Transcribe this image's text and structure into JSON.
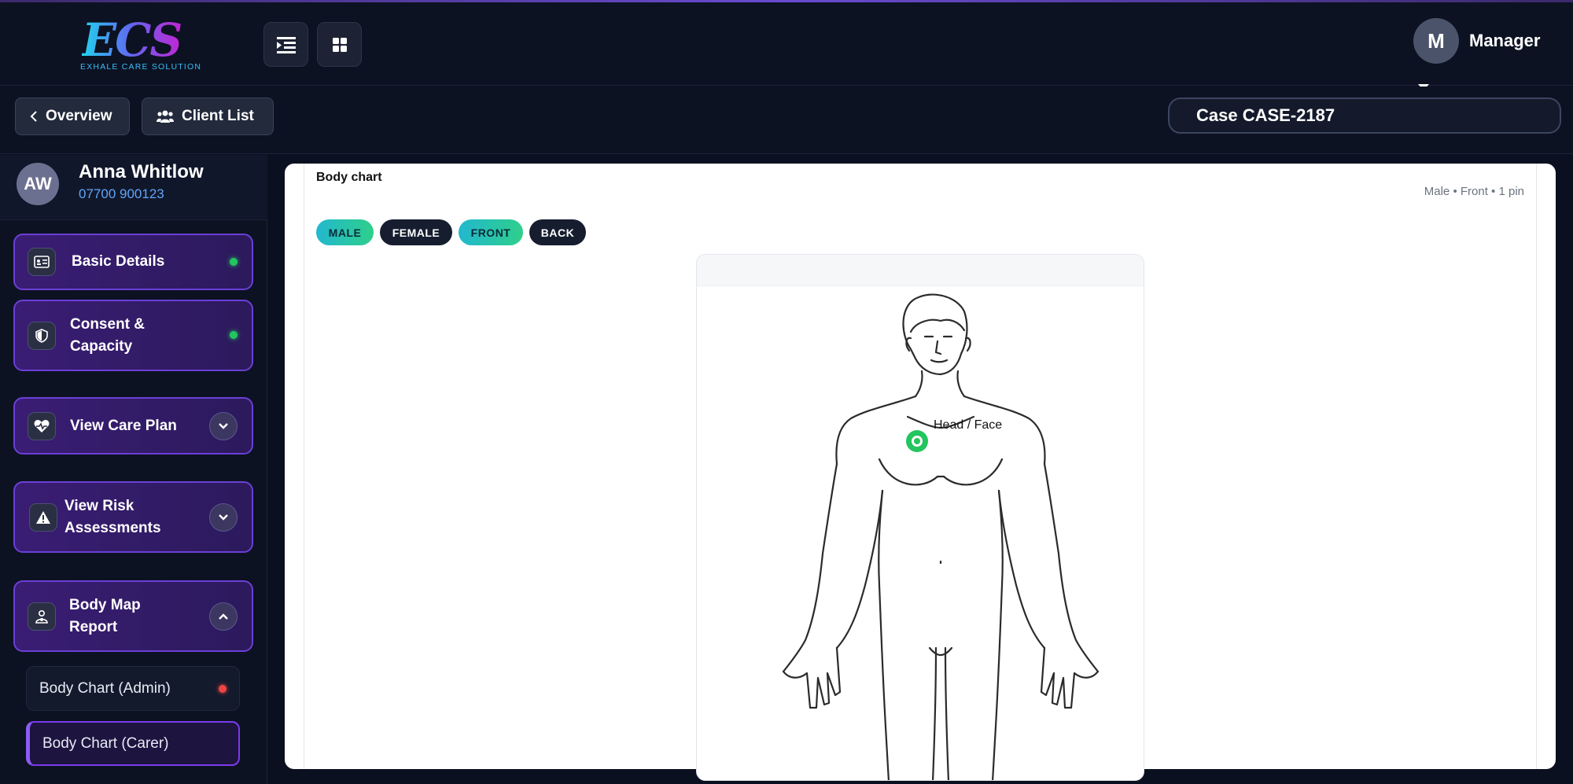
{
  "brand": {
    "logo_text": "ECS",
    "tagline": "EXHALE CARE SOLUTION"
  },
  "header": {
    "buttons": [
      {
        "icon": "collapse-menu-icon"
      },
      {
        "icon": "grid-icon"
      }
    ],
    "user": {
      "initial": "M",
      "name": "Manager"
    }
  },
  "toolbar": {
    "overview_label": "Overview",
    "client_list_label": "Client List",
    "case_value": "Case CASE-2187"
  },
  "client": {
    "initials": "AW",
    "name": "Anna Whitlow",
    "phone": "07700 900123"
  },
  "sidebar": {
    "items": [
      {
        "label": "Basic Details",
        "icon": "id-card-icon",
        "status": "green"
      },
      {
        "label": "Consent &\nCapacity",
        "icon": "shield-icon",
        "status": "green"
      },
      {
        "label": "View Care Plan",
        "icon": "heart-pulse-icon",
        "chevron": "down"
      },
      {
        "label": "View Risk\nAssessments",
        "icon": "warning-icon",
        "chevron": "down"
      },
      {
        "label": "Body Map\nReport",
        "icon": "person-icon",
        "chevron": "up"
      }
    ],
    "sub_items": [
      {
        "label": "Body Chart (Admin)",
        "status": "red"
      },
      {
        "label": "Body Chart (Carer)",
        "active": true
      }
    ]
  },
  "body_chart": {
    "title": "Body chart",
    "meta": "Male • Front • 1 pin",
    "toggles": [
      {
        "label": "MALE",
        "selected": true
      },
      {
        "label": "FEMALE",
        "selected": false
      },
      {
        "label": "FRONT",
        "selected": true
      },
      {
        "label": "BACK",
        "selected": false
      }
    ],
    "pin_label": "Head / Face"
  },
  "colors": {
    "accent": "#7c3aed",
    "status_green": "#22c55e",
    "status_red": "#ef4444",
    "toggle_on": "#22b8cf"
  }
}
